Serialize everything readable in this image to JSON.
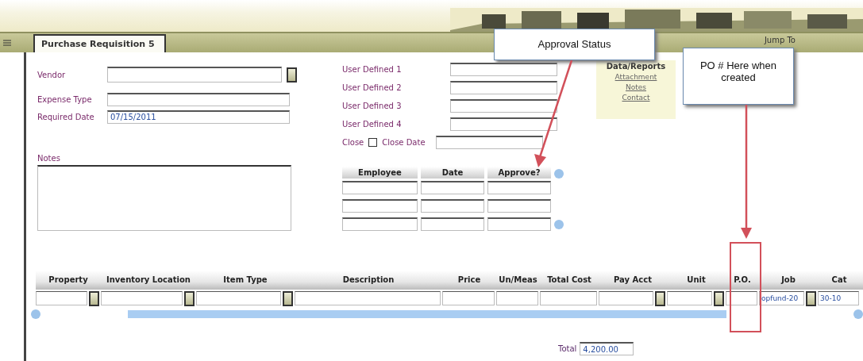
{
  "tab": {
    "label": "Purchase Requisition 5",
    "selected": true
  },
  "jump_to": "Jump To",
  "left_fields": [
    {
      "label": "Vendor",
      "kind": "lookup"
    },
    {
      "label": "Expense Type",
      "kind": "text"
    },
    {
      "label": "Required Date",
      "kind": "text",
      "value": "07/15/2011"
    }
  ],
  "notes": {
    "label": "Notes"
  },
  "user_fields": [
    {
      "label": "User Defined 1"
    },
    {
      "label": "User Defined 2"
    },
    {
      "label": "User Defined 3"
    },
    {
      "label": "User Defined 4"
    }
  ],
  "close": {
    "label": "Close",
    "checked": false,
    "date_label": "Close Date"
  },
  "approvals": {
    "columns": [
      "Employee",
      "Date",
      "Approve?"
    ]
  },
  "data_reports": {
    "title": "Data/Reports",
    "links": [
      "Attachment",
      "Notes",
      "Contact"
    ]
  },
  "grid": {
    "columns": [
      {
        "label": "Property",
        "lookup": true
      },
      {
        "label": "Inventory Location",
        "lookup": true
      },
      {
        "label": "Item Type",
        "lookup": true
      },
      {
        "label": "Description",
        "lookup": false
      },
      {
        "label": "Price",
        "lookup": false
      },
      {
        "label": "Un/Meas",
        "lookup": false
      },
      {
        "label": "Total Cost",
        "lookup": false
      },
      {
        "label": "Pay Acct",
        "lookup": true
      },
      {
        "label": "Unit",
        "lookup": true
      },
      {
        "label": "P.O.",
        "lookup": false
      },
      {
        "label": "Job",
        "lookup": true,
        "value": "opfund-20"
      },
      {
        "label": "Cat",
        "lookup": false,
        "value": "30-10"
      }
    ]
  },
  "total": {
    "label": "Total",
    "value": "4,200.00"
  },
  "callouts": [
    {
      "text": "Approval Status"
    },
    {
      "text": "PO # Here when created"
    }
  ]
}
